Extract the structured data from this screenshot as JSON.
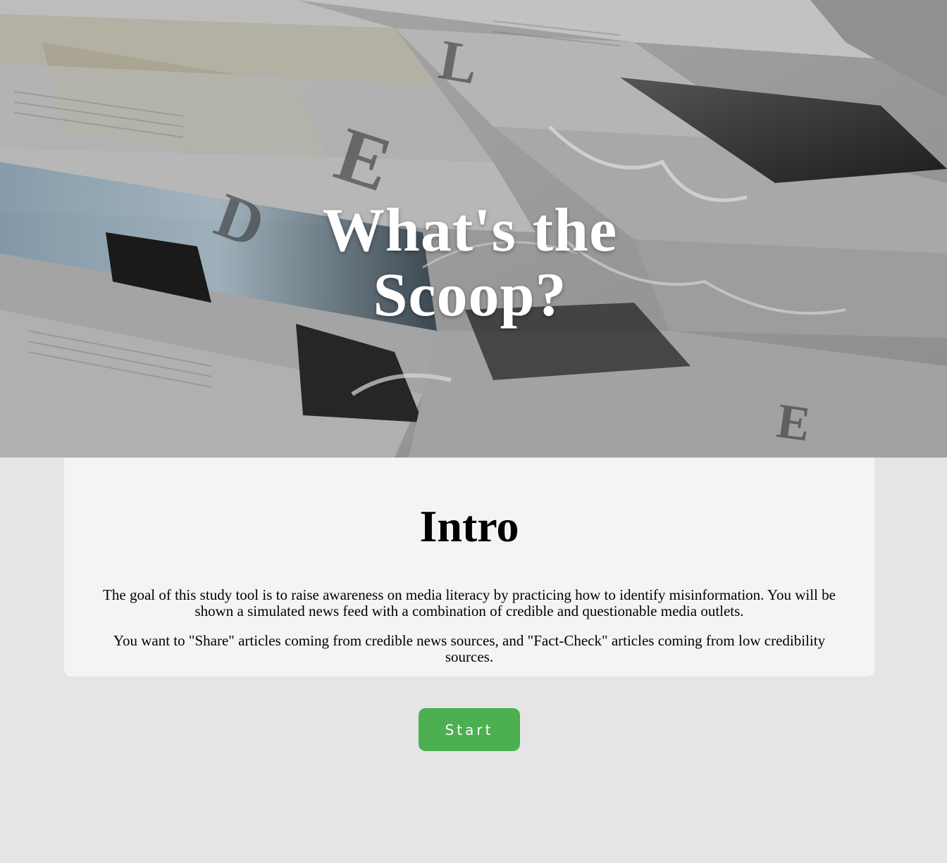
{
  "hero": {
    "image": "newspaper-stack-photo",
    "title_line1": "What's the",
    "title_line2": "Scoop?"
  },
  "intro": {
    "heading": "Intro",
    "paragraph1": "The goal of this study tool is to raise awareness on media literacy by practicing how to identify misinformation. You will be shown a simulated news feed with a combination of credible and questionable media outlets.",
    "paragraph2": "You want to \"Share\" articles coming from credible news sources, and \"Fact-Check\" articles coming from low credibility sources."
  },
  "actions": {
    "start_label": "Start"
  },
  "colors": {
    "page_background": "#e5e5e5",
    "card_background": "#f4f4f4",
    "start_button": "#4caf50",
    "hero_text": "#ffffff"
  }
}
